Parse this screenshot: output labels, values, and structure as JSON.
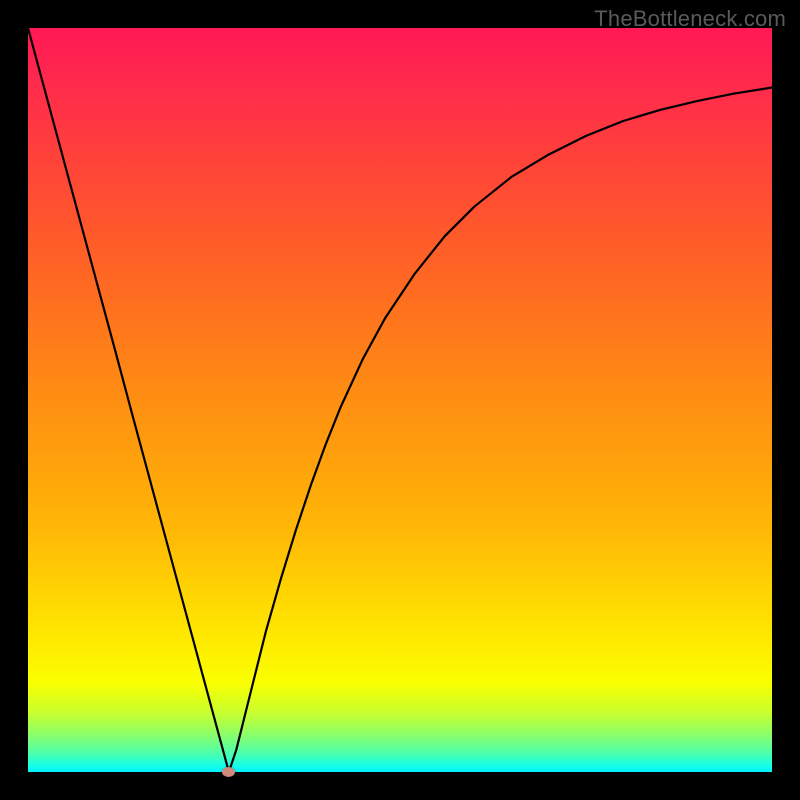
{
  "watermark": "TheBottleneck.com",
  "colors": {
    "page_background": "#000000",
    "curve_stroke": "#000000",
    "marker_fill": "#cf8a7c",
    "gradient_top": "#ff1955",
    "gradient_bottom": "#00f0ff"
  },
  "chart_data": {
    "type": "line",
    "title": "",
    "xlabel": "",
    "ylabel": "",
    "xlim": [
      0,
      100
    ],
    "ylim": [
      0,
      100
    ],
    "x": [
      0,
      2,
      4,
      6,
      8,
      10,
      12,
      14,
      16,
      18,
      20,
      22,
      24,
      26,
      27,
      28,
      29,
      30,
      32,
      34,
      36,
      38,
      40,
      42,
      45,
      48,
      52,
      56,
      60,
      65,
      70,
      75,
      80,
      85,
      90,
      95,
      100
    ],
    "y": [
      100,
      92.6,
      85.2,
      77.8,
      70.4,
      63.0,
      55.6,
      48.1,
      40.7,
      33.3,
      25.9,
      18.5,
      11.1,
      3.7,
      0.0,
      3.0,
      7.0,
      11.0,
      19.0,
      26.0,
      32.5,
      38.5,
      44.0,
      49.0,
      55.5,
      61.0,
      67.0,
      72.0,
      76.0,
      80.0,
      83.0,
      85.5,
      87.5,
      89.0,
      90.2,
      91.2,
      92.0
    ],
    "marker": {
      "x": 27,
      "y": 0
    },
    "grid": false,
    "legend": false
  }
}
